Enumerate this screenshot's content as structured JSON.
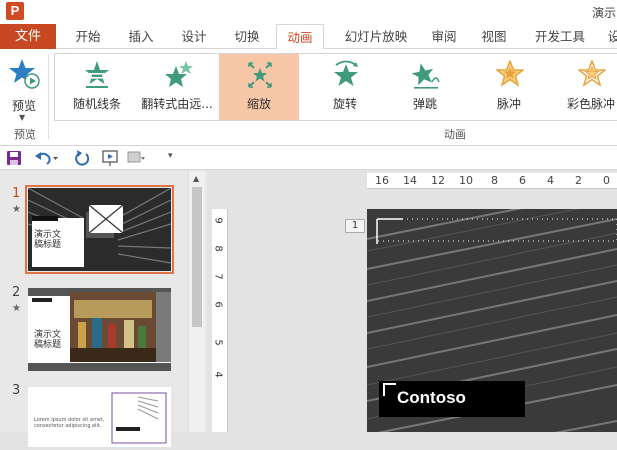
{
  "window": {
    "app_icon": "P",
    "title": "演示"
  },
  "ribbon_tabs": [
    "文件",
    "开始",
    "插入",
    "设计",
    "切换",
    "动画",
    "幻灯片放映",
    "审阅",
    "视图",
    "开发工具",
    "设"
  ],
  "active_tab": "动画",
  "preview": {
    "label": "预览",
    "group_label": "预览"
  },
  "animations": {
    "items": [
      {
        "label": "随机线条",
        "icon": "star-lines-icon",
        "color": "#3f9b7a"
      },
      {
        "label": "翻转式由远...",
        "icon": "star-flip-icon",
        "color": "#3f9b7a"
      },
      {
        "label": "缩放",
        "icon": "star-zoom-icon",
        "color": "#3f9b7a",
        "selected": true
      },
      {
        "label": "旋转",
        "icon": "star-spin-icon",
        "color": "#3f9b7a"
      },
      {
        "label": "弹跳",
        "icon": "star-bounce-icon",
        "color": "#3f9b7a"
      },
      {
        "label": "脉冲",
        "icon": "star-pulse-icon",
        "color": "#e8a23a"
      },
      {
        "label": "彩色脉冲",
        "icon": "star-color-pulse-icon",
        "color": "#e8a23a"
      }
    ],
    "group_label": "动画"
  },
  "slides": [
    {
      "number": "1",
      "has_animation": true,
      "title": "演示文稿标题"
    },
    {
      "number": "2",
      "has_animation": true,
      "title": "演示文稿标题"
    },
    {
      "number": "3",
      "has_animation": false,
      "text": "Lorem ipsum dolor sit amet, consectetur adipiscing elit."
    }
  ],
  "rulers": {
    "horizontal": [
      "16",
      "14",
      "12",
      "10",
      "8",
      "6",
      "4",
      "2",
      "0"
    ],
    "vertical": [
      "9",
      "8",
      "7",
      "6",
      "5",
      "4"
    ]
  },
  "canvas": {
    "slide_badge": "1",
    "title_text": "Contoso"
  },
  "colors": {
    "accent": "#c84821",
    "selected_anim": "#f7c7a8",
    "star_green": "#3f9b7a",
    "star_gold": "#e8a23a"
  }
}
